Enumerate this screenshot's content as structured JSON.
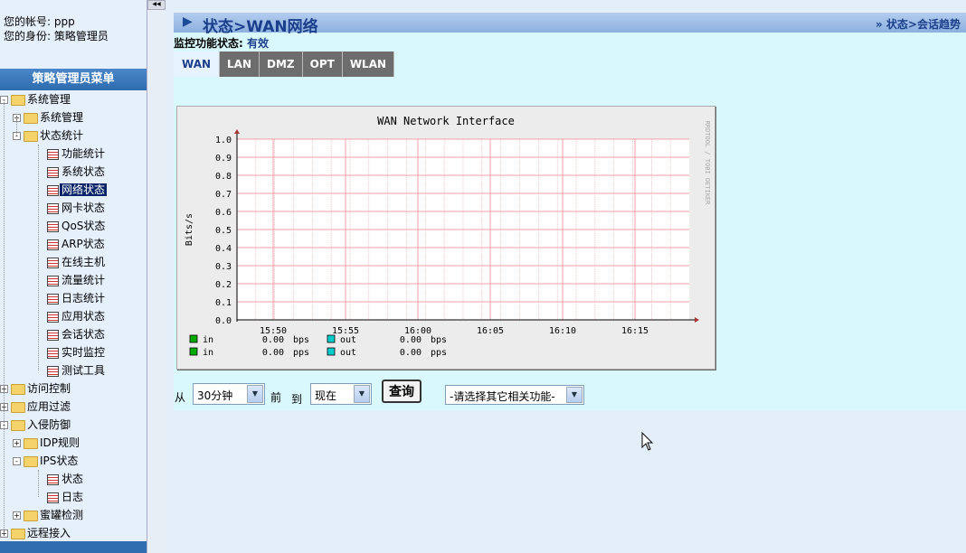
{
  "account": {
    "line1": "您的帐号: ppp",
    "line2": "您的身份: 策略管理员"
  },
  "menu_header": "策略管理员菜单",
  "tree": [
    {
      "label": "系统管理",
      "level": 0,
      "kind": "folder",
      "exp": "-"
    },
    {
      "label": "系统管理",
      "level": 1,
      "kind": "folder",
      "exp": "+"
    },
    {
      "label": "状态统计",
      "level": 1,
      "kind": "folder",
      "exp": "-"
    },
    {
      "label": "功能统计",
      "level": 2,
      "kind": "page"
    },
    {
      "label": "系统状态",
      "level": 2,
      "kind": "page"
    },
    {
      "label": "网络状态",
      "level": 2,
      "kind": "page",
      "selected": true
    },
    {
      "label": "网卡状态",
      "level": 2,
      "kind": "page"
    },
    {
      "label": "QoS状态",
      "level": 2,
      "kind": "page"
    },
    {
      "label": "ARP状态",
      "level": 2,
      "kind": "page"
    },
    {
      "label": "在线主机",
      "level": 2,
      "kind": "page"
    },
    {
      "label": "流量统计",
      "level": 2,
      "kind": "page"
    },
    {
      "label": "日志统计",
      "level": 2,
      "kind": "page"
    },
    {
      "label": "应用状态",
      "level": 2,
      "kind": "page"
    },
    {
      "label": "会话状态",
      "level": 2,
      "kind": "page"
    },
    {
      "label": "实时监控",
      "level": 2,
      "kind": "page"
    },
    {
      "label": "测试工具",
      "level": 2,
      "kind": "page"
    },
    {
      "label": "访问控制",
      "level": 0,
      "kind": "folder",
      "exp": "+"
    },
    {
      "label": "应用过滤",
      "level": 0,
      "kind": "folder",
      "exp": "+"
    },
    {
      "label": "入侵防御",
      "level": 0,
      "kind": "folder",
      "exp": "-"
    },
    {
      "label": "IDP规则",
      "level": 1,
      "kind": "folder",
      "exp": "+"
    },
    {
      "label": "IPS状态",
      "level": 1,
      "kind": "folder",
      "exp": "-"
    },
    {
      "label": "状态",
      "level": 2,
      "kind": "page"
    },
    {
      "label": "日志",
      "level": 2,
      "kind": "page"
    },
    {
      "label": "蜜罐检测",
      "level": 1,
      "kind": "folder",
      "exp": "+"
    },
    {
      "label": "远程接入",
      "level": 0,
      "kind": "folder",
      "exp": "+"
    }
  ],
  "header": {
    "title": "状态>WAN网络",
    "breadcrumb": "» 状态>会话趋势"
  },
  "status": {
    "label": "监控功能状态: ",
    "value": "有效"
  },
  "tabs": [
    {
      "label": "WAN",
      "active": true
    },
    {
      "label": "LAN",
      "active": false
    },
    {
      "label": "DMZ",
      "active": false
    },
    {
      "label": "OPT",
      "active": false
    },
    {
      "label": "WLAN",
      "active": false
    }
  ],
  "chart_data": {
    "type": "line",
    "title": "WAN Network Interface",
    "ylabel": "Bits/s",
    "xlabel": "",
    "side_label": "RRDTOOL / TOBI OETIKER",
    "ylim": [
      0,
      1.0
    ],
    "y_ticks": [
      "0.0",
      "0.1",
      "0.2",
      "0.3",
      "0.4",
      "0.5",
      "0.6",
      "0.7",
      "0.8",
      "0.9",
      "1.0"
    ],
    "x_ticks": [
      "15:50",
      "15:55",
      "16:00",
      "16:05",
      "16:10",
      "16:15"
    ],
    "grid": true,
    "legend": [
      {
        "name": "in",
        "value": "0.00",
        "unit": "bps",
        "color": "#00aa00"
      },
      {
        "name": "out",
        "value": "0.00",
        "unit": "bps",
        "color": "#00cccc"
      },
      {
        "name": "in",
        "value": "0.00",
        "unit": "pps",
        "color": "#00aa00"
      },
      {
        "name": "out",
        "value": "0.00",
        "unit": "pps",
        "color": "#00cccc"
      }
    ],
    "series": []
  },
  "query": {
    "from_label": "从",
    "range_value": "30分钟",
    "before_label": "前",
    "to_label": "到",
    "to_value": "现在",
    "button_label": "查询",
    "related_value": "-请选择其它相关功能-"
  },
  "colors": {
    "grid": "#f0a0a8",
    "axis": "#000000",
    "title_bar": "#8cb0e0",
    "panel": "#d9f8fc"
  }
}
